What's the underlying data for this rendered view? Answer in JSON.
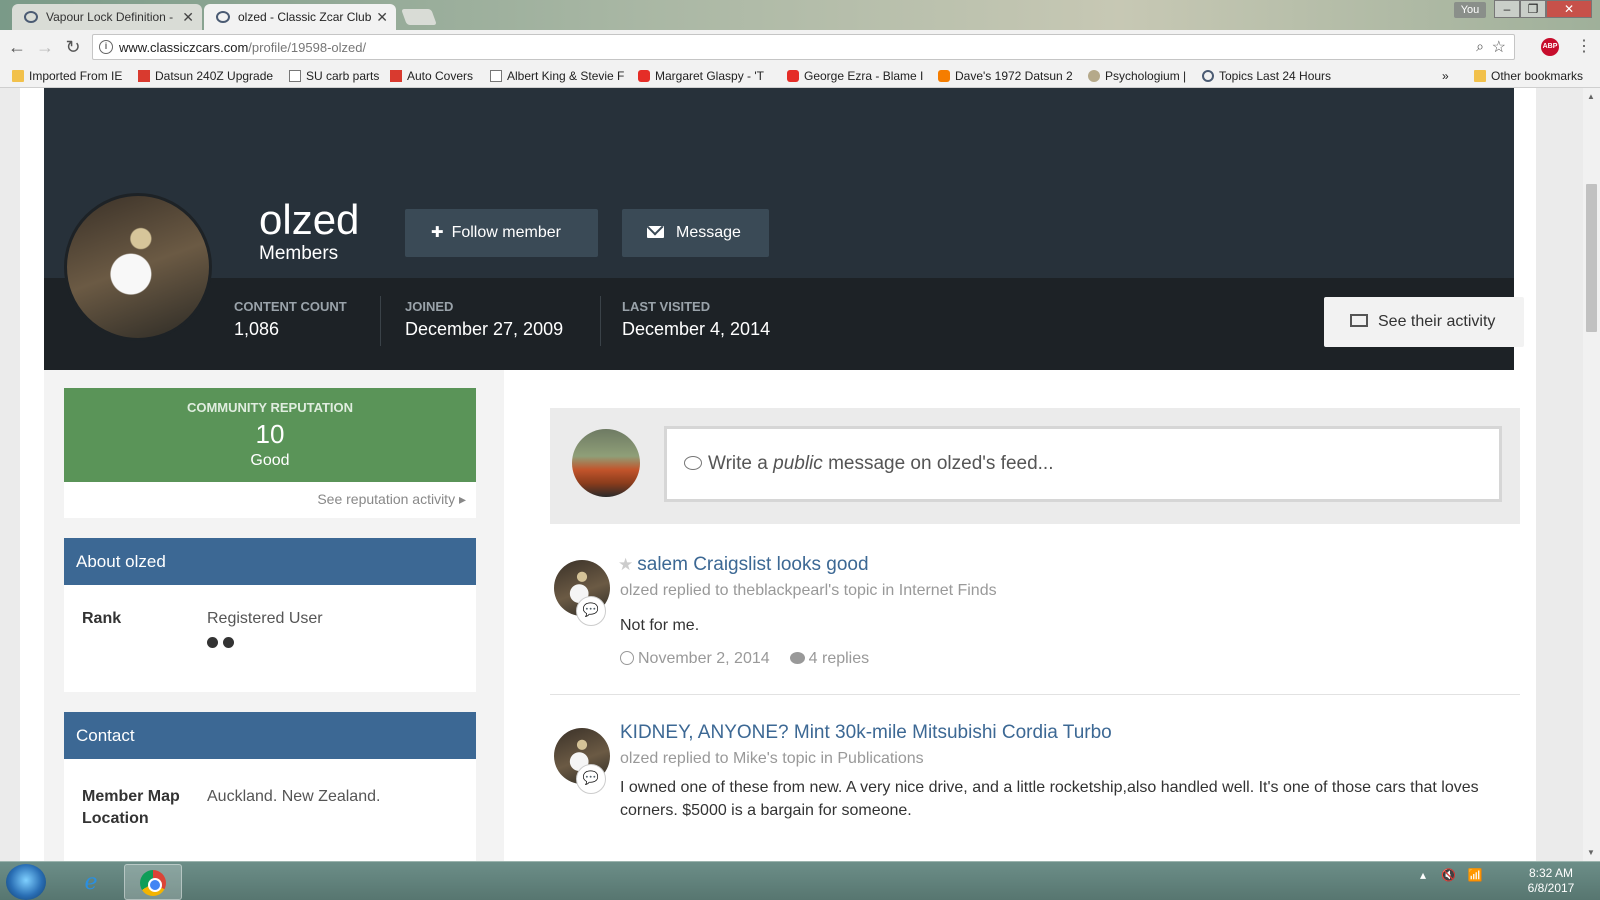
{
  "browser": {
    "tabs": [
      {
        "title": "Vapour Lock Definition -",
        "active": false
      },
      {
        "title": "olzed - Classic Zcar Club",
        "active": true
      }
    ],
    "profile_chip": "You",
    "url_host": "www.classiczcars.com",
    "url_path": "/profile/19598-olzed/",
    "abp_badge": "ABP",
    "bookmarks": [
      {
        "label": "Imported From IE",
        "icon": "folder-icon"
      },
      {
        "label": "Datsun 240Z Upgrade",
        "icon": "datsun-icon"
      },
      {
        "label": "SU carb parts",
        "icon": "page-icon"
      },
      {
        "label": "Auto Covers",
        "icon": "shield-icon"
      },
      {
        "label": "Albert King & Stevie F",
        "icon": "page-icon"
      },
      {
        "label": "Margaret Glaspy - 'T",
        "icon": "youtube-icon"
      },
      {
        "label": "George Ezra - Blame I",
        "icon": "youtube-icon"
      },
      {
        "label": "Dave's 1972 Datsun 2",
        "icon": "blogger-icon"
      },
      {
        "label": "Psychologium |",
        "icon": "orb-icon"
      },
      {
        "label": "Topics Last 24 Hours",
        "icon": "zcar-icon"
      }
    ],
    "bookmarks_overflow": "»",
    "other_bookmarks": "Other bookmarks"
  },
  "profile": {
    "username": "olzed",
    "group": "Members",
    "follow_label": "Follow member",
    "message_label": "Message",
    "stats": [
      {
        "label": "Content Count",
        "value": "1,086"
      },
      {
        "label": "Joined",
        "value": "December 27, 2009"
      },
      {
        "label": "Last Visited",
        "value": "December 4, 2014"
      }
    ],
    "activity_label": "See their activity"
  },
  "reputation": {
    "label": "Community Reputation",
    "value": "10",
    "description": "Good",
    "link": "See reputation activity",
    "color": "#5a9458"
  },
  "about": {
    "title": "About olzed",
    "rank_label": "Rank",
    "rank_value": "Registered User",
    "rank_pips": 2
  },
  "contact": {
    "title": "Contact",
    "location_label_line1": "Member Map",
    "location_label_line2": "Location",
    "location_value": "Auckland. New Zealand."
  },
  "feed": {
    "composer_prefix": "Write a",
    "composer_emphasis": "public",
    "composer_suffix": "message on olzed's feed...",
    "items": [
      {
        "title": "salem Craigslist looks good",
        "meta": "olzed replied to theblackpearl's topic in Internet Finds",
        "body": "Not for me.",
        "date": "November 2, 2014",
        "replies": "4 replies"
      },
      {
        "title": "KIDNEY, ANYONE? Mint 30k-mile Mitsubishi Cordia Turbo",
        "meta": "olzed replied to Mike's topic in Publications",
        "body": "I owned one of these from new. A very nice drive, and a little rocketship,also handled well. It's one of those cars that loves corners. $5000 is a bargain for someone."
      }
    ]
  },
  "taskbar": {
    "time": "8:32 AM",
    "date": "6/8/2017"
  },
  "colors": {
    "cover": "#27313a",
    "stats_bar": "#1d2226",
    "widget_header": "#3c6894",
    "link": "#3c6894"
  }
}
